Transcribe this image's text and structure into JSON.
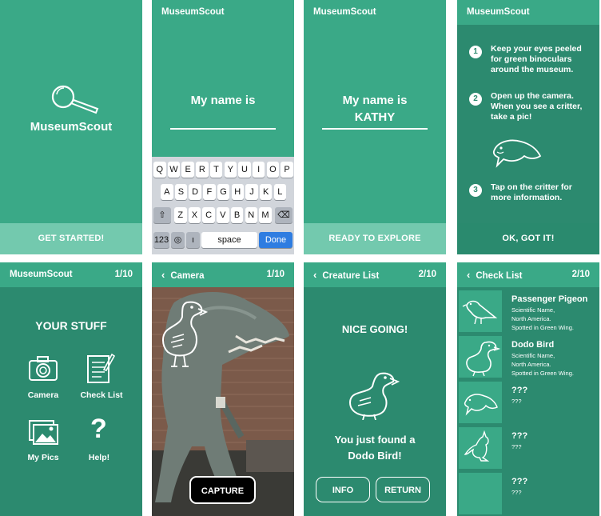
{
  "colors": {
    "green": "#3aa987",
    "dark_green": "#2c8a6f",
    "pale_band": "#73c9ae",
    "ios_blue": "#2f7de1"
  },
  "splash": {
    "title": "MuseumScout",
    "button": "GET STARTED!",
    "icon": "magnifier-icon"
  },
  "name_entry": {
    "app_title": "MuseumScout",
    "prompt": "My name is",
    "keyboard": {
      "row1": [
        "Q",
        "W",
        "E",
        "R",
        "T",
        "Y",
        "U",
        "I",
        "O",
        "P"
      ],
      "row2": [
        "A",
        "S",
        "D",
        "F",
        "G",
        "H",
        "J",
        "K",
        "L"
      ],
      "row3": [
        "Z",
        "X",
        "C",
        "V",
        "B",
        "N",
        "M"
      ],
      "shift_icon": "shift-icon",
      "delete_icon": "delete-icon",
      "num_key": "123",
      "globe_icon": "globe-icon",
      "mic_icon": "mic-icon",
      "space": "space",
      "done": "Done"
    }
  },
  "name_done": {
    "app_title": "MuseumScout",
    "prompt": "My name is",
    "name": "KATHY",
    "button": "READY TO EXPLORE"
  },
  "instructions": {
    "app_title": "MuseumScout",
    "steps": [
      {
        "num": "1",
        "text": "Keep your eyes peeled for green binoculars around the museum."
      },
      {
        "num": "2",
        "text": "Open up the camera. When you see a critter, take a pic!"
      },
      {
        "num": "3",
        "text": "Tap on the critter for more information."
      }
    ],
    "critter_icon": "manatee-icon",
    "button": "OK, GOT IT!"
  },
  "your_stuff": {
    "app_title": "MuseumScout",
    "count": "1/10",
    "heading": "YOUR STUFF",
    "tiles": [
      {
        "label": "Camera",
        "icon": "camera-icon"
      },
      {
        "label": "Check List",
        "icon": "checklist-icon"
      },
      {
        "label": "My Pics",
        "icon": "photos-icon"
      },
      {
        "label": "Help!",
        "icon": "help-icon"
      }
    ]
  },
  "camera": {
    "title": "Camera",
    "count": "1/10",
    "capture": "CAPTURE",
    "subject_icon": "dodo-icon",
    "back_icon": "chevron-left-icon"
  },
  "creature_list": {
    "title": "Creature List",
    "count": "2/10",
    "heading": "NICE GOING!",
    "message": "You just found a Dodo Bird!",
    "info_btn": "INFO",
    "return_btn": "RETURN"
  },
  "check_list": {
    "title": "Check List",
    "count": "2/10",
    "items": [
      {
        "name": "Passenger Pigeon",
        "desc": "Scientific Name,\nNorth America.\nSpotted in Green Wing.",
        "icon": "pigeon-icon"
      },
      {
        "name": "Dodo Bird",
        "desc": "Scientific Name,\nNorth America.\nSpotted in Green Wing.",
        "icon": "dodo-icon"
      },
      {
        "name": "???",
        "desc": "???",
        "icon": "manatee-icon"
      },
      {
        "name": "???",
        "desc": "???",
        "icon": "kangaroo-icon"
      },
      {
        "name": "???",
        "desc": "???",
        "icon": ""
      }
    ]
  }
}
